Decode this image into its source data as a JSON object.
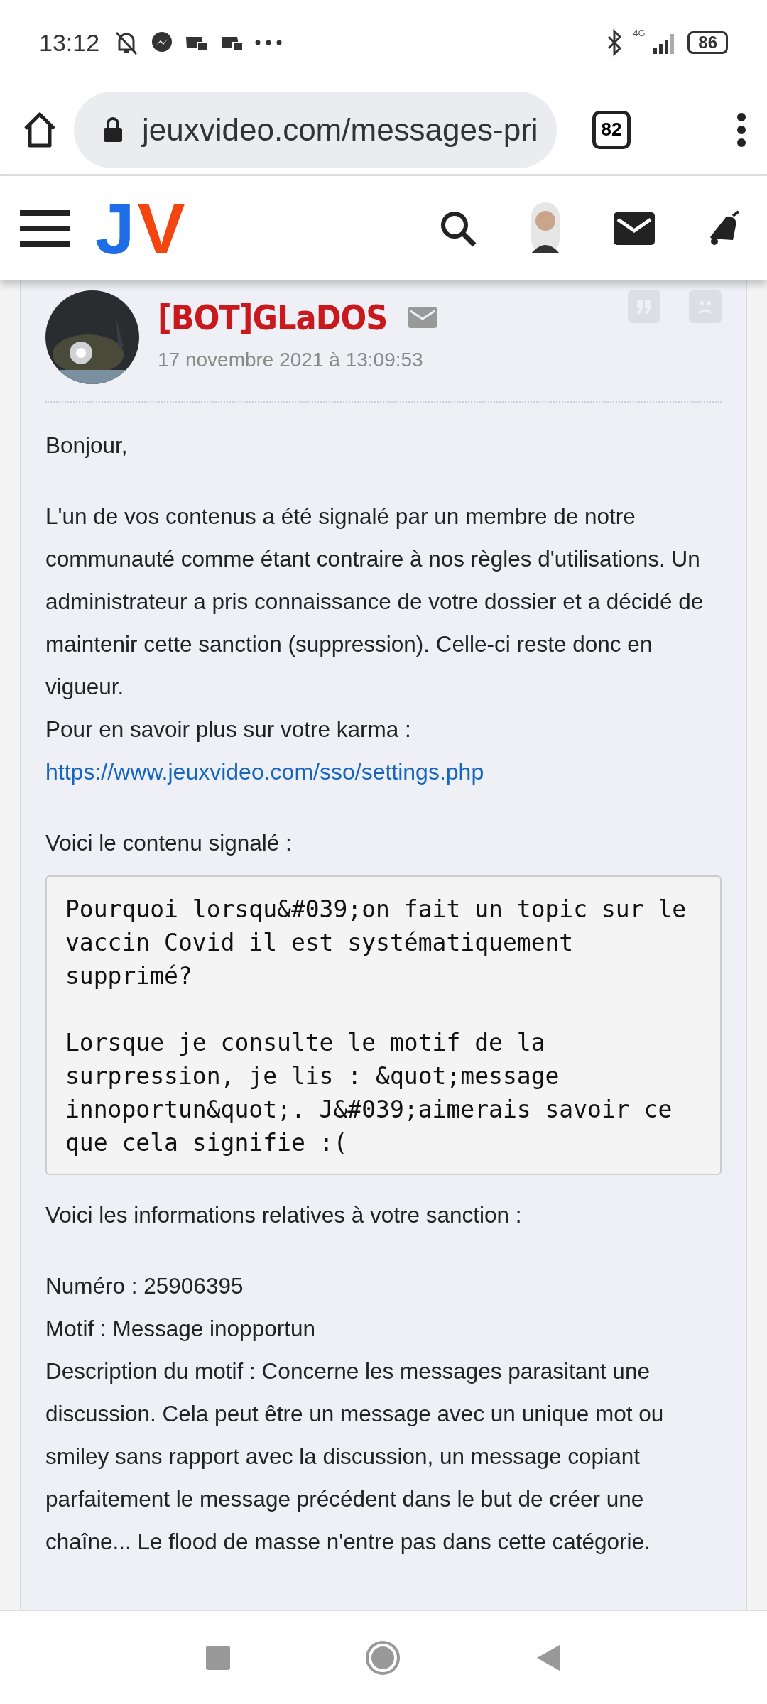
{
  "status_bar": {
    "time": "13:12",
    "network": "4G+",
    "battery": "86"
  },
  "browser": {
    "url": "jeuxvideo.com/messages-pri",
    "tab_count": "82"
  },
  "site_header": {
    "logo": "JV"
  },
  "message": {
    "author": "[BOT]GLaDOS",
    "date": "17 novembre 2021 à 13:09:53",
    "greeting": "Bonjour,",
    "paragraph": "L'un de vos contenus a été signalé par un membre de notre communauté comme étant contraire à nos règles d'utilisations. Un administrateur a pris connaissance de votre dossier et a décidé de maintenir cette sanction (suppression). Celle-ci reste donc en vigueur.",
    "karma_label": "Pour en savoir plus sur votre karma :",
    "karma_link": "https://www.jeuxvideo.com/sso/settings.php",
    "reported_label": "Voici le contenu signalé :",
    "reported_content": [
      "Pourquoi lorsqu&#039;on fait un topic sur le vaccin Covid il est systématiquement supprimé?",
      "Lorsque je consulte le motif de la surpression, je lis : &quot;message innoportun&quot;. J&#039;aimerais savoir ce que cela signifie :("
    ],
    "sanction_label": "Voici les informations relatives à votre sanction :",
    "sanction_lines": [
      "Numéro : 25906395",
      "Motif : Message inopportun",
      "Description du motif : Concerne les messages parasitant une discussion. Cela peut être un message avec un unique mot ou smiley sans rapport avec la discussion, un message copiant parfaitement le message précédent dans le but de créer une chaîne... Le flood de masse n'entre pas dans cette catégorie."
    ]
  }
}
